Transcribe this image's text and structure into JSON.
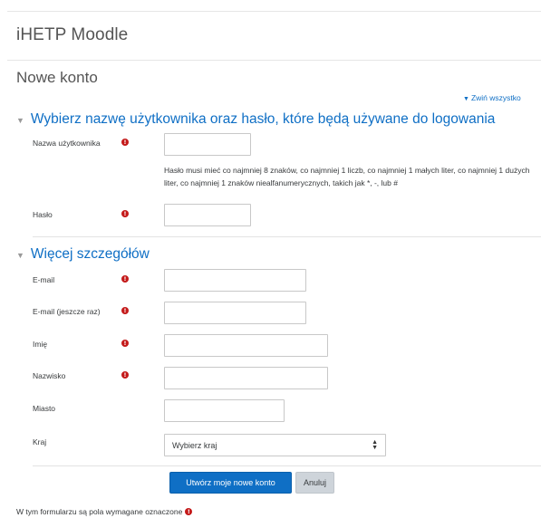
{
  "site": {
    "title": "iHETP Moodle"
  },
  "page": {
    "title": "Nowe konto",
    "collapse_all": "Zwiń wszystko"
  },
  "section_general": {
    "title": "Wybierz nazwę użytkownika oraz hasło, które będą używane do logowania",
    "username_label": "Nazwa użytkownika",
    "username_value": "",
    "password_hint": "Hasło musi mieć co najmniej 8 znaków, co najmniej 1 liczb, co najmniej 1 małych liter, co najmniej 1 dużych liter, co najmniej 1 znaków niealfanumerycznych, takich jak *, -, lub #",
    "password_label": "Hasło",
    "password_value": ""
  },
  "section_details": {
    "title": "Więcej szczegółów",
    "email_label": "E-mail",
    "email_value": "",
    "email2_label": "E-mail (jeszcze raz)",
    "email2_value": "",
    "firstname_label": "Imię",
    "firstname_value": "",
    "lastname_label": "Nazwisko",
    "lastname_value": "",
    "city_label": "Miasto",
    "city_value": "",
    "country_label": "Kraj",
    "country_selected": "Wybierz kraj"
  },
  "buttons": {
    "submit": "Utwórz moje nowe konto",
    "cancel": "Anuluj"
  },
  "footer": {
    "required_note": "W tym formularzu są pola wymagane oznaczone"
  },
  "icons": {
    "required": "exclamation-circle-icon",
    "section_toggle": "caret-down-icon",
    "select_arrows": "sort-arrows-icon"
  },
  "colors": {
    "link": "#0f6fc5",
    "required": "#c41a1a",
    "primary_button": "#0f6fc5",
    "secondary_button": "#ced4da"
  }
}
